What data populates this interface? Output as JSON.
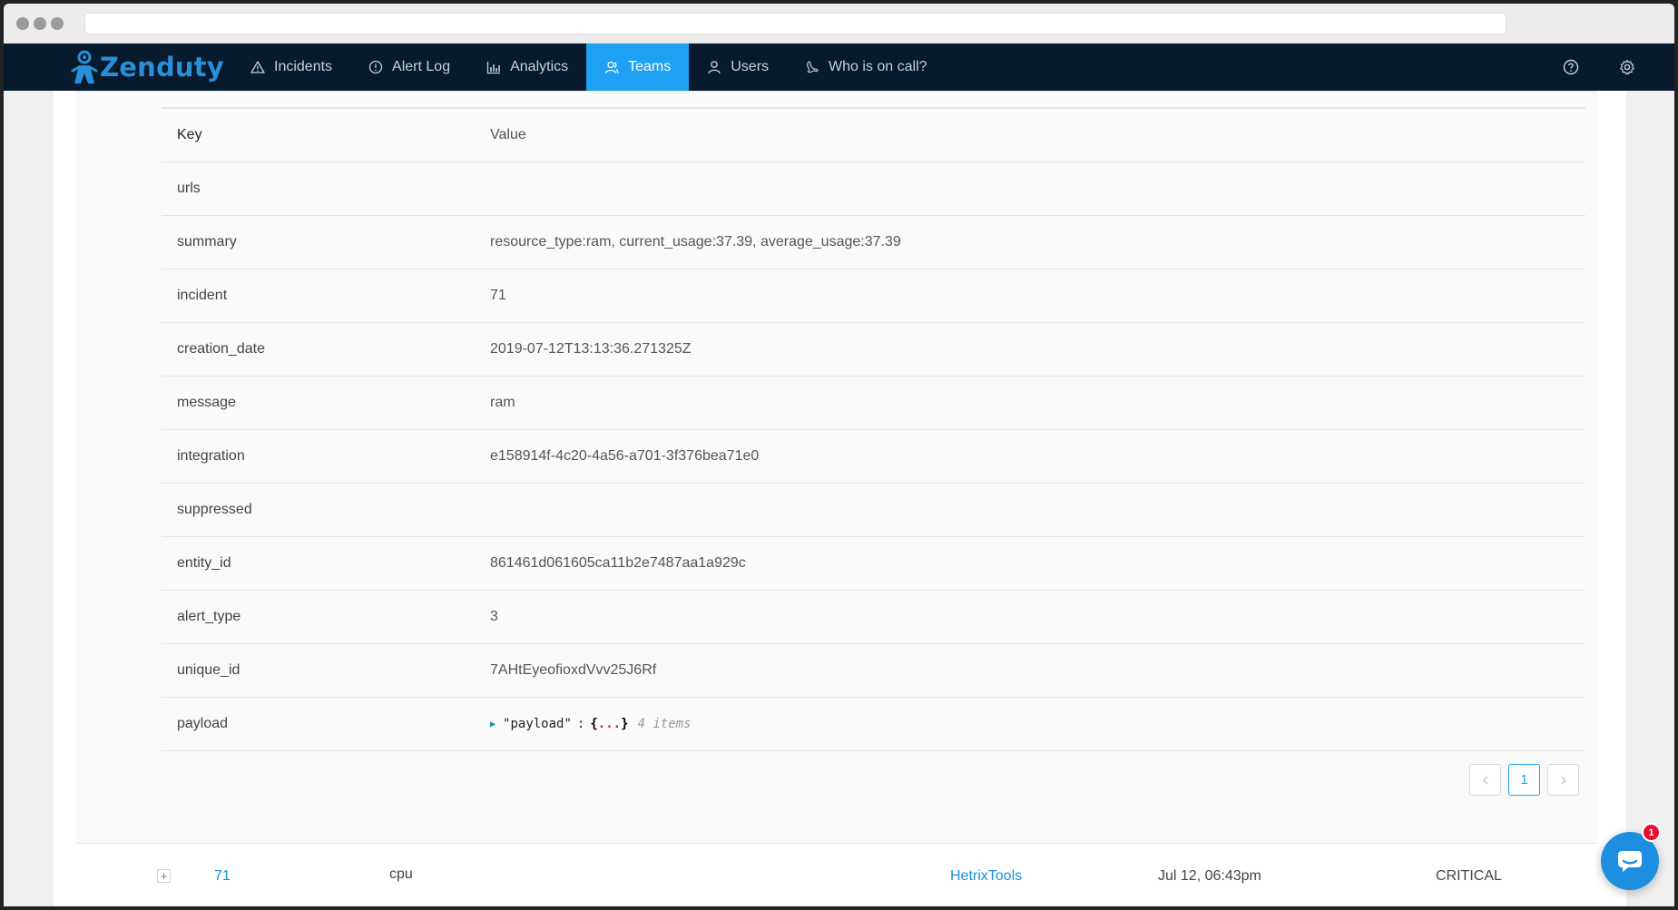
{
  "brand": {
    "name": "Zenduty",
    "color": "#2b8fd6"
  },
  "nav": {
    "items": [
      {
        "label": "Incidents",
        "icon": "warning-triangle-icon"
      },
      {
        "label": "Alert Log",
        "icon": "info-circle-icon"
      },
      {
        "label": "Analytics",
        "icon": "bar-chart-icon"
      },
      {
        "label": "Teams",
        "icon": "team-icon",
        "active": true
      },
      {
        "label": "Users",
        "icon": "user-icon"
      },
      {
        "label": "Who is on call?",
        "icon": "phone-icon"
      }
    ],
    "right_icons": [
      "help-circle-icon",
      "gear-icon"
    ],
    "active_color": "#1ea1f2",
    "bg_color": "#071a2e"
  },
  "detail_table": {
    "header": {
      "key": "Key",
      "value": "Value"
    },
    "rows": [
      {
        "key": "urls",
        "value": ""
      },
      {
        "key": "summary",
        "value": "resource_type:ram, current_usage:37.39, average_usage:37.39"
      },
      {
        "key": "incident",
        "value": "71"
      },
      {
        "key": "creation_date",
        "value": "2019-07-12T13:13:36.271325Z"
      },
      {
        "key": "message",
        "value": "ram"
      },
      {
        "key": "integration",
        "value": "e158914f-4c20-4a56-a701-3f376bea71e0"
      },
      {
        "key": "suppressed",
        "value": ""
      },
      {
        "key": "entity_id",
        "value": "861461d061605ca11b2e7487aa1a929c"
      },
      {
        "key": "alert_type",
        "value": "3"
      },
      {
        "key": "unique_id",
        "value": "7AHtEyeofioxdVvv25J6Rf"
      }
    ],
    "payload_row": {
      "key": "payload",
      "json_key": "\"payload\"",
      "colon": ":",
      "brace_open": "{",
      "ellipsis": "...",
      "brace_close": "}",
      "count": "4 items"
    }
  },
  "pagination": {
    "current": "1"
  },
  "alert_row": {
    "expand": "+",
    "incident": "71",
    "message": "cpu",
    "integration": "HetrixTools",
    "time": "Jul 12, 06:43pm",
    "severity": "CRITICAL"
  },
  "chat": {
    "badge": "1",
    "color": "#1e8fe0"
  }
}
